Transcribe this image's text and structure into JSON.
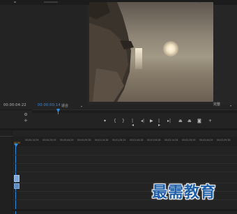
{
  "source_monitor": {
    "timecode": "00:00:04:22"
  },
  "program_monitor": {
    "timecode": "00;00;00;14",
    "fit_label": "适合",
    "zoom_label": "完整"
  },
  "controls": [
    {
      "name": "add-marker-icon",
      "glyph": "▾"
    },
    {
      "name": "mark-in-icon",
      "glyph": "{"
    },
    {
      "name": "mark-out-icon",
      "glyph": "}"
    },
    {
      "name": "go-to-in-icon",
      "glyph": "|◂"
    },
    {
      "name": "step-back-icon",
      "glyph": "◂|"
    },
    {
      "name": "play-icon",
      "glyph": "▶"
    },
    {
      "name": "step-forward-icon",
      "glyph": "|▸"
    },
    {
      "name": "go-to-out-icon",
      "glyph": "▸|"
    },
    {
      "name": "lift-icon",
      "glyph": "⏏"
    },
    {
      "name": "extract-icon",
      "glyph": "⏏"
    },
    {
      "name": "export-frame-icon",
      "glyph": "◙"
    },
    {
      "name": "button-editor-icon",
      "glyph": "+"
    }
  ],
  "timeline": {
    "zero_label": "00;00",
    "ruler_ticks": [
      "00;00;14;29",
      "00;00;29;29",
      "00;00;44;29",
      "00;00;59;28",
      "00;01;14;28",
      "00;01;29;29",
      "00;01;44;28",
      "00;01;59;28",
      "00;02;14;28",
      "00;02;29;29",
      "00;02;44;29",
      "00;02;59;28"
    ]
  },
  "watermark": {
    "text": "最需教育"
  },
  "colors": {
    "accent": "#2f8de4",
    "panel": "#232323",
    "watermark": "#1f5fa8",
    "clip": "#7fa7d8"
  }
}
